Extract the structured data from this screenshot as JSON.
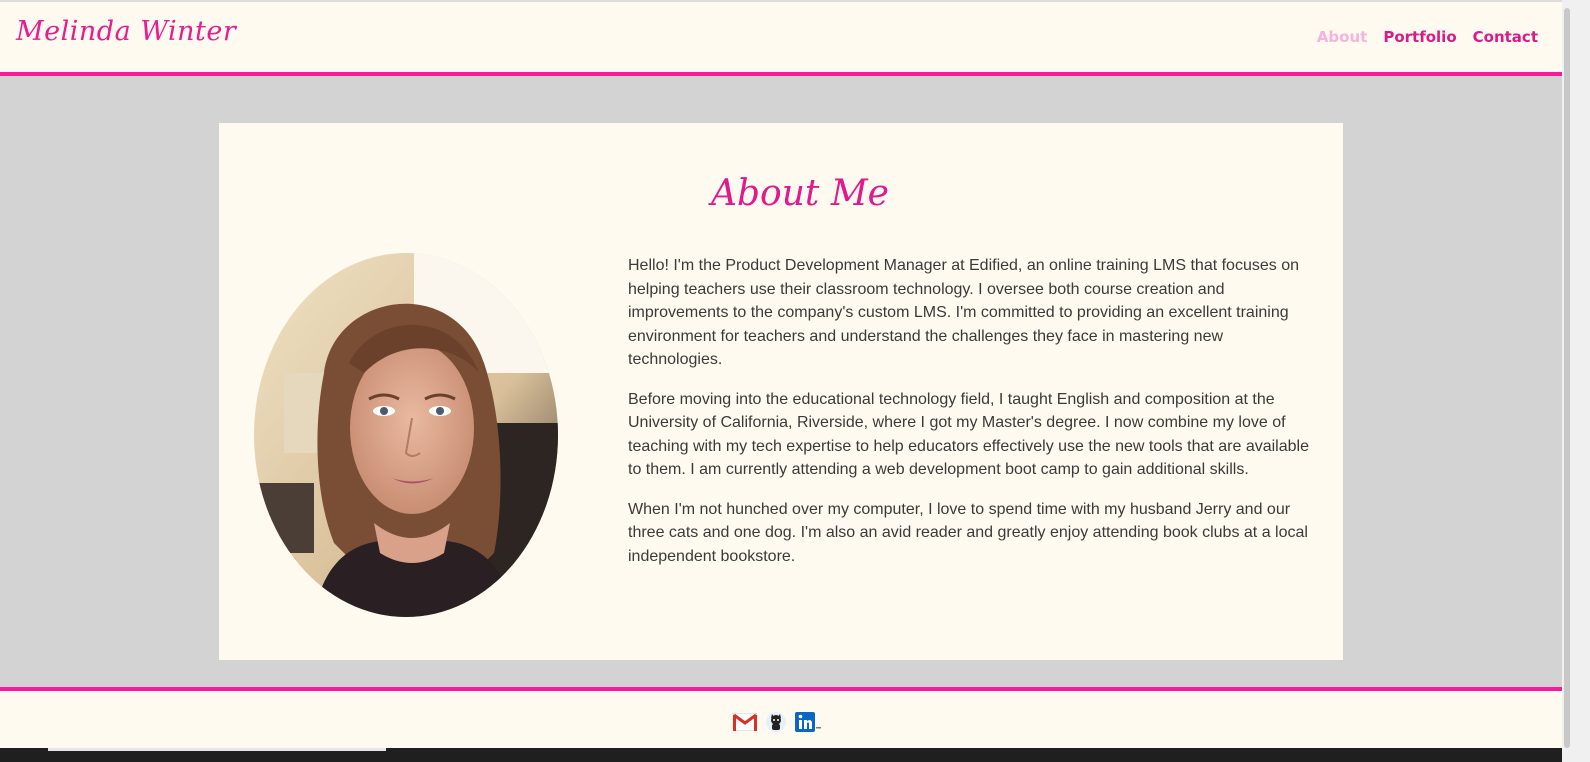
{
  "header": {
    "brand": "Melinda Winter",
    "nav": [
      {
        "label": "About",
        "active": true
      },
      {
        "label": "Portfolio",
        "active": false
      },
      {
        "label": "Contact",
        "active": false
      }
    ]
  },
  "about": {
    "title": "About Me",
    "paragraphs": [
      "Hello! I'm the Product Development Manager at Edified, an online training LMS that focuses on helping teachers use their classroom technology. I oversee both course creation and improvements to the company's custom LMS. I'm committed to providing an excellent training environment for teachers and understand the challenges they face in mastering new technologies.",
      "Before moving into the educational technology field, I taught English and composition at the University of California, Riverside, where I got my Master's degree. I now combine my love of teaching with my tech expertise to help educators effectively use the new tools that are available to them. I am currently attending a web development boot camp to gain additional skills.",
      "When I'm not hunched over my computer, I love to spend time with my husband Jerry and our three cats and one dog. I'm also an avid reader and greatly enjoy attending book clubs at a local independent bookstore."
    ]
  },
  "footer": {
    "social_icons": [
      "gmail-icon",
      "github-icon",
      "linkedin-icon"
    ]
  },
  "colors": {
    "accent": "#f51c9c",
    "background": "#d3d3d3",
    "card": "#fffaef",
    "nav_active": "#f7b2de"
  }
}
